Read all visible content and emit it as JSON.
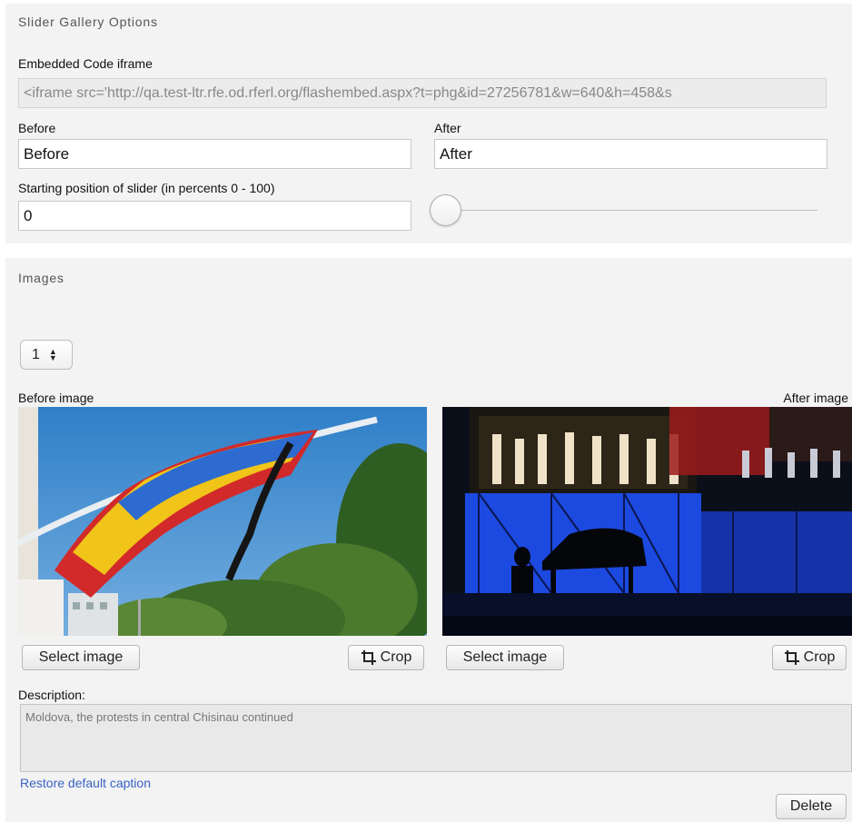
{
  "slider_options": {
    "title": "Slider Gallery Options",
    "embed_label": "Embedded Code iframe",
    "embed_value": "<iframe src='http://qa.test-ltr.rfe.od.rferl.org/flashembed.aspx?t=phg&id=27256781&w=640&h=458&s",
    "before_label": "Before",
    "before_value": "Before",
    "after_label": "After",
    "after_value": "After",
    "start_label": "Starting position of slider (in percents 0 - 100)",
    "start_value": "0",
    "slider_position_percent": 0
  },
  "images": {
    "title": "Images",
    "index_selected": "1",
    "before_label": "Before image",
    "after_label": "After image",
    "select_label": "Select image",
    "crop_label": "Crop",
    "description_label": "Description:",
    "description_value": "Moldova, the protests in central Chisinau continued",
    "restore_link": "Restore default caption",
    "delete_label": "Delete"
  },
  "icons": {
    "crop": "crop-icon",
    "select_arrows": "updown-arrows-icon"
  },
  "colors": {
    "panel_bg": "#f3f3f3",
    "link": "#3a63c4",
    "section_title": "#555555"
  }
}
